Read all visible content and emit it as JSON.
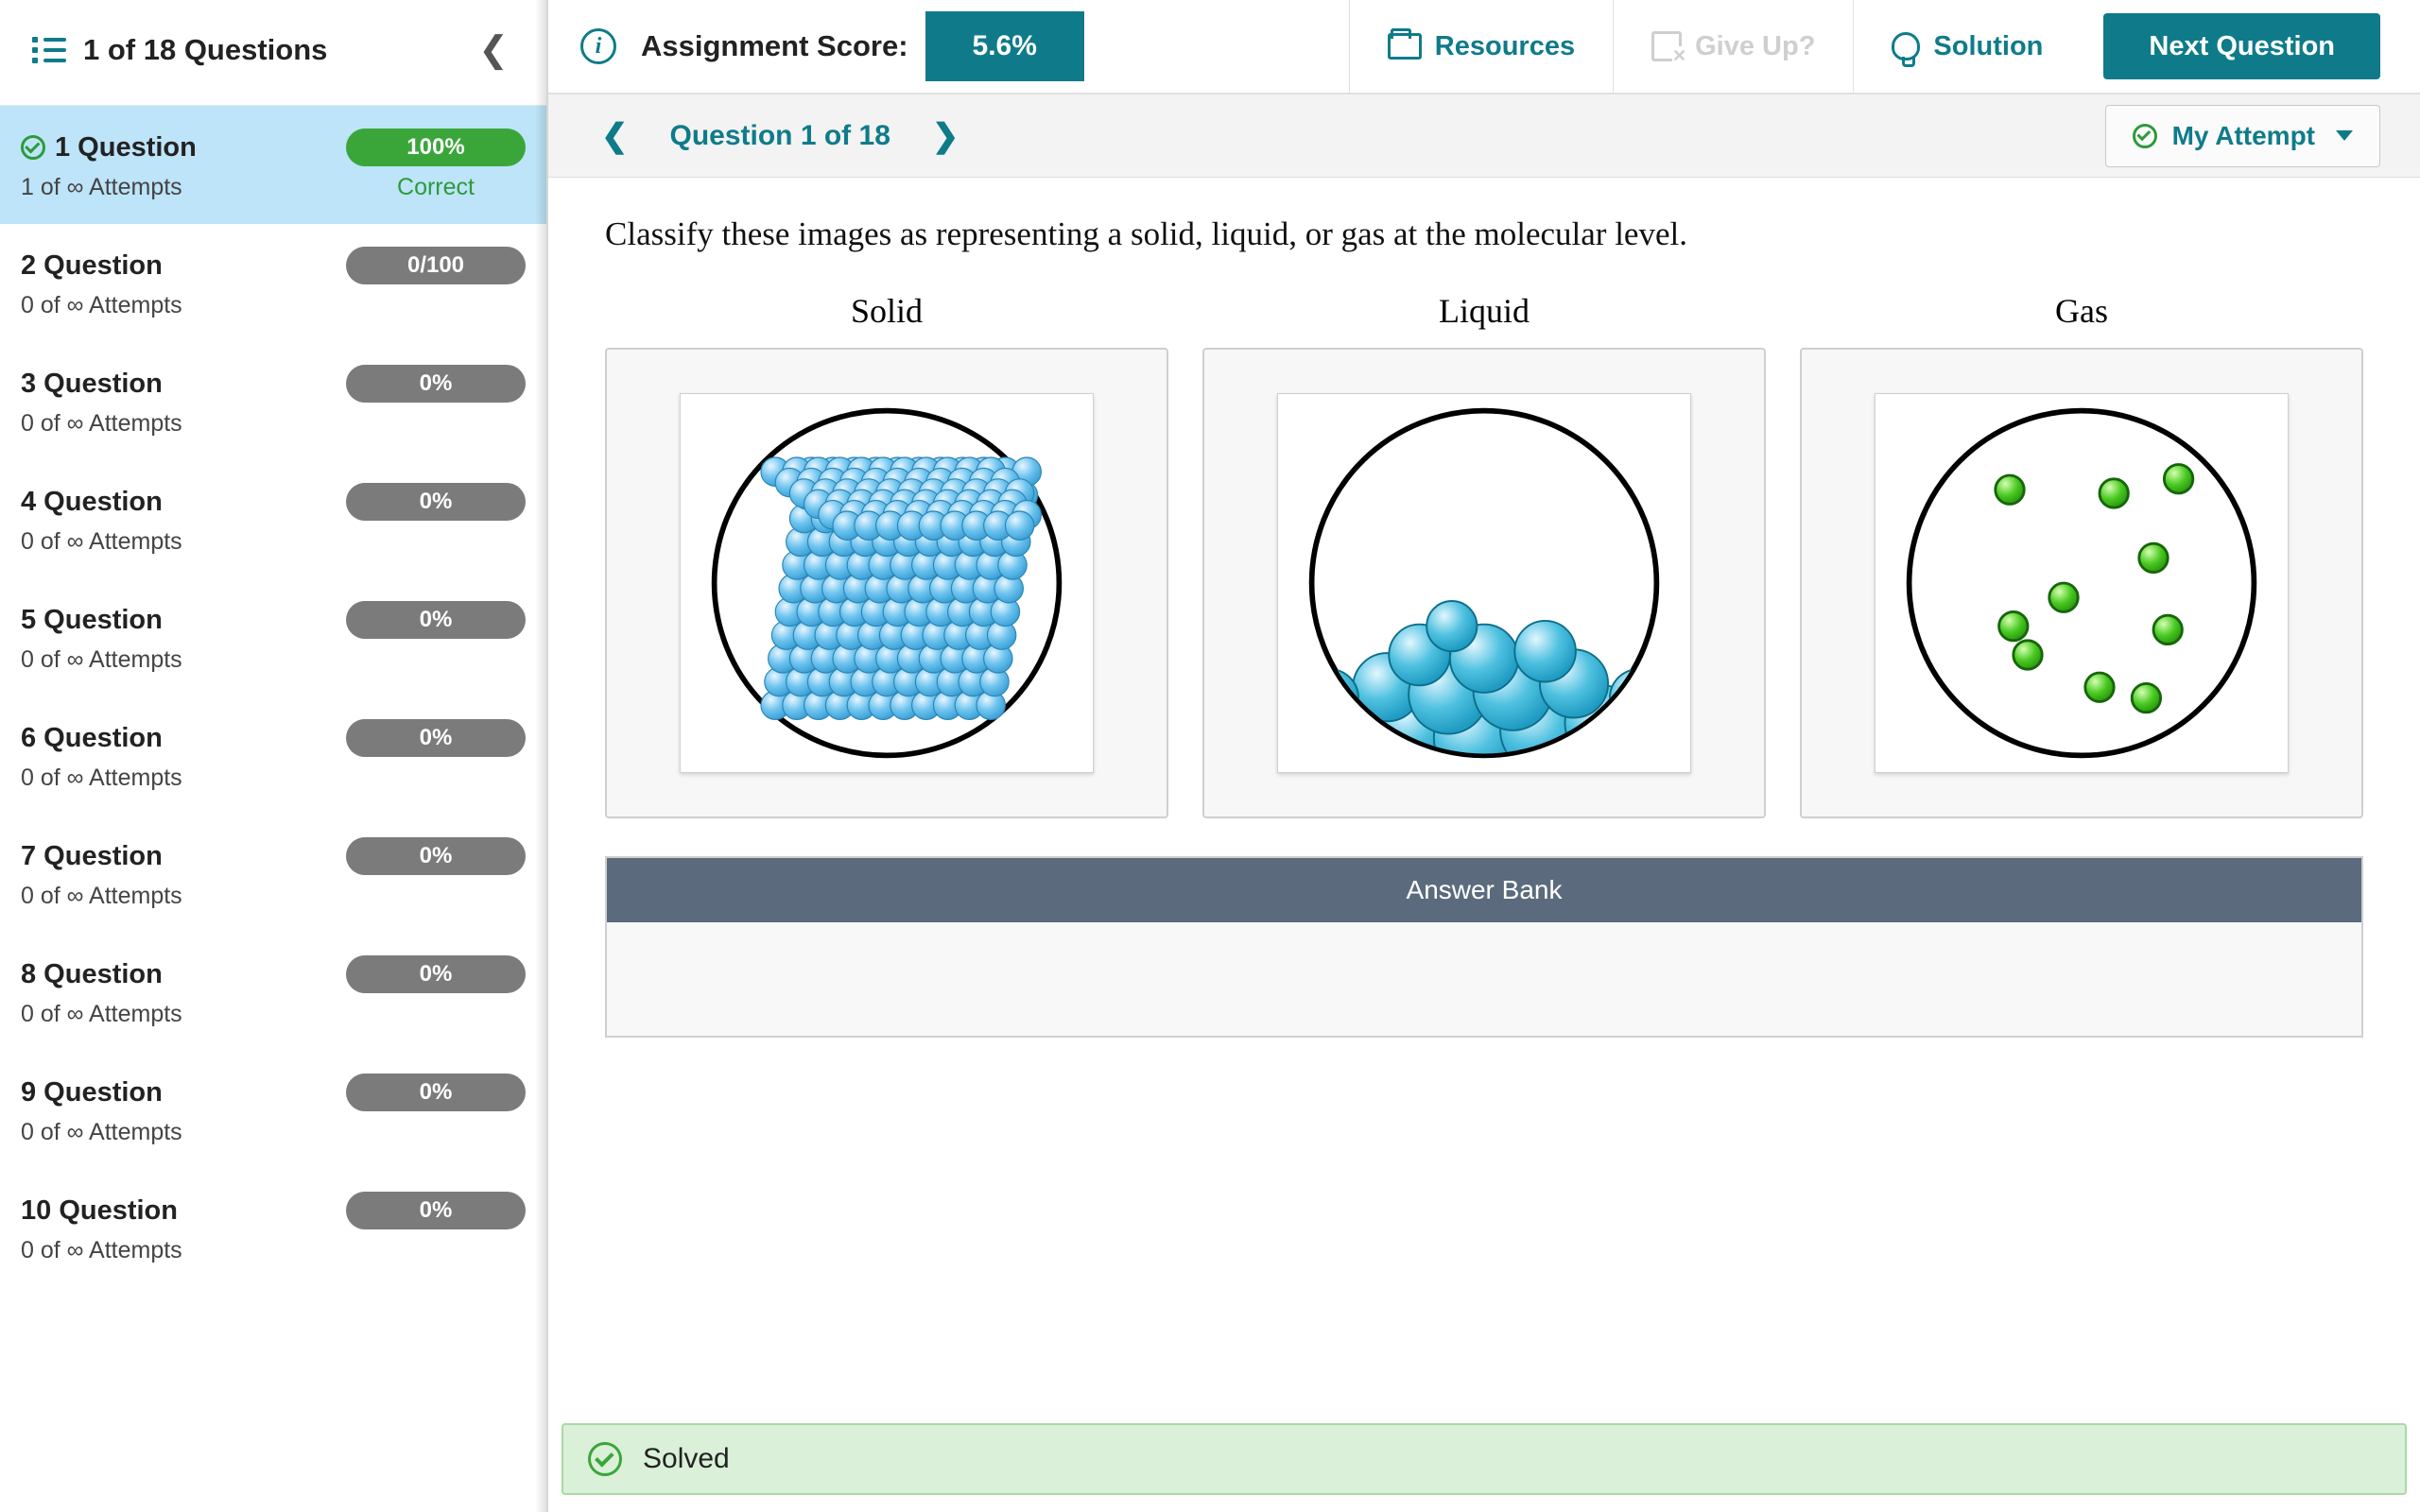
{
  "sidebar": {
    "title": "1 of 18 Questions",
    "questions": [
      {
        "name": "1 Question",
        "pill": "100%",
        "pill_class": "green",
        "attempts": "1 of ∞ Attempts",
        "status": "Correct",
        "current": true,
        "checked": true
      },
      {
        "name": "2 Question",
        "pill": "0/100",
        "pill_class": "gray",
        "attempts": "0 of ∞ Attempts",
        "status": ""
      },
      {
        "name": "3 Question",
        "pill": "0%",
        "pill_class": "gray",
        "attempts": "0 of ∞ Attempts",
        "status": ""
      },
      {
        "name": "4 Question",
        "pill": "0%",
        "pill_class": "gray",
        "attempts": "0 of ∞ Attempts",
        "status": ""
      },
      {
        "name": "5 Question",
        "pill": "0%",
        "pill_class": "gray",
        "attempts": "0 of ∞ Attempts",
        "status": ""
      },
      {
        "name": "6 Question",
        "pill": "0%",
        "pill_class": "gray",
        "attempts": "0 of ∞ Attempts",
        "status": ""
      },
      {
        "name": "7 Question",
        "pill": "0%",
        "pill_class": "gray",
        "attempts": "0 of ∞ Attempts",
        "status": ""
      },
      {
        "name": "8 Question",
        "pill": "0%",
        "pill_class": "gray",
        "attempts": "0 of ∞ Attempts",
        "status": ""
      },
      {
        "name": "9 Question",
        "pill": "0%",
        "pill_class": "gray",
        "attempts": "0 of ∞ Attempts",
        "status": ""
      },
      {
        "name": "10 Question",
        "pill": "0%",
        "pill_class": "gray",
        "attempts": "0 of ∞ Attempts",
        "status": ""
      }
    ]
  },
  "topbar": {
    "score_label": "Assignment Score:",
    "score_value": "5.6%",
    "resources": "Resources",
    "giveup": "Give Up?",
    "solution": "Solution",
    "next": "Next Question"
  },
  "subbar": {
    "qnum": "Question 1 of 18",
    "attempt": "My Attempt"
  },
  "content": {
    "prompt": "Classify these images as representing a solid, liquid, or gas at the molecular level.",
    "zones": [
      "Solid",
      "Liquid",
      "Gas"
    ],
    "answer_bank_label": "Answer Bank"
  },
  "footer": {
    "status": "Solved"
  }
}
